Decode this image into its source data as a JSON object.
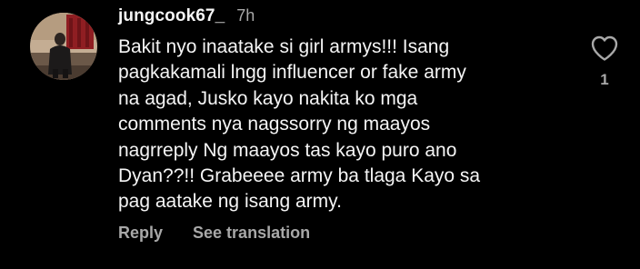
{
  "comment": {
    "username": "jungcook67_",
    "timestamp": "7h",
    "text": "Bakit nyo inaatake si girl armys!!! Isang\npagkakamali lngg influencer or fake army\nna agad, Jusko kayo nakita ko mga\ncomments nya nagssorry ng maayos\nnagrreply Ng maayos tas kayo puro ano\nDyan??!! Grabeeee army ba tlaga Kayo sa\npag aatake ng isang army.",
    "like_count": "1",
    "actions": {
      "reply_label": "Reply",
      "translate_label": "See translation"
    },
    "avatar_icon": "profile-photo",
    "like_icon": "heart-outline-icon"
  },
  "colors": {
    "background": "#000000",
    "primary_text": "#f5f5f5",
    "secondary_text": "#a8a8a8"
  }
}
